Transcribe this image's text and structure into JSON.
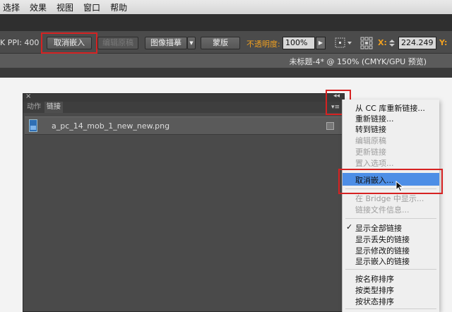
{
  "menubar": {
    "items": [
      "选择",
      "效果",
      "视图",
      "窗口",
      "帮助"
    ]
  },
  "controlbar": {
    "ppi_label": "K  PPI: 400",
    "unembed_label": "取消嵌入",
    "edit_original_label": "编辑原稿",
    "image_trace_label": "图像描摹",
    "mask_label": "蒙版",
    "opacity_label": "不透明度:",
    "opacity_value": "100%",
    "x_label": "X:",
    "x_value": "224.249 n",
    "y_label": "Y:"
  },
  "document": {
    "tab_title": "未标题-4* @ 150% (CMYK/GPU 预览)"
  },
  "links_panel": {
    "tabs": [
      "动作",
      "链接"
    ],
    "active_tab": "链接",
    "rows": [
      {
        "file_name": "a_pc_14_mob_1_new_new.png"
      }
    ]
  },
  "context_menu": {
    "groups": [
      [
        {
          "label": "从 CC 库重新链接...",
          "enabled": true
        },
        {
          "label": "重新链接...",
          "enabled": true
        },
        {
          "label": "转到链接",
          "enabled": true
        },
        {
          "label": "编辑原稿",
          "enabled": false
        },
        {
          "label": "更新链接",
          "enabled": false
        },
        {
          "label": "置入选项...",
          "enabled": false
        }
      ],
      [
        {
          "label": "取消嵌入...",
          "enabled": true,
          "highlighted": true
        }
      ],
      [
        {
          "label": "在 Bridge 中显示...",
          "enabled": false
        },
        {
          "label": "链接文件信息...",
          "enabled": false
        }
      ],
      [
        {
          "label": "显示全部链接",
          "enabled": true,
          "checked": true
        },
        {
          "label": "显示丢失的链接",
          "enabled": true
        },
        {
          "label": "显示修改的链接",
          "enabled": true
        },
        {
          "label": "显示嵌入的链接",
          "enabled": true
        }
      ],
      [
        {
          "label": "按名称排序",
          "enabled": true
        },
        {
          "label": "按类型排序",
          "enabled": true
        },
        {
          "label": "按状态排序",
          "enabled": true
        }
      ]
    ]
  },
  "colors": {
    "highlight": "#4d8ee6",
    "annotation": "#d62222",
    "accent_label": "#f0a020"
  }
}
